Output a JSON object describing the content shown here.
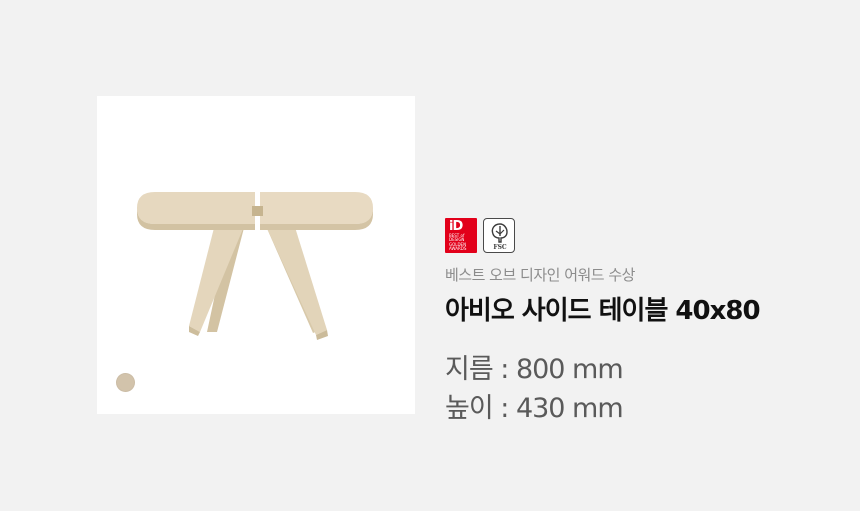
{
  "product": {
    "image": {
      "alt": "아비오 사이드 테이블 40x80 product image",
      "colors": {
        "wood_light": "#e6d8bf",
        "wood_mid": "#ddcfb2",
        "wood_dark": "#c9b894",
        "shadow": "#b9a886"
      }
    },
    "color_swatch": {
      "color": "#d2c3ab"
    },
    "badges": {
      "design_award": {
        "icon": "design-award-logo-icon",
        "color": "#e2001a",
        "logo_text": [
          "BEST of",
          "DESIGN",
          "GOLDEN",
          "AWARDS"
        ]
      },
      "fsc": {
        "icon": "fsc-tree-logo-icon",
        "label": "FSC"
      }
    },
    "subtitle": "베스트 오브 디자인 어워드 수상",
    "title": "아비오 사이드 테이블 40x80",
    "specs": {
      "diameter": "지름 : 800 mm",
      "height": "높이 : 430 mm"
    }
  }
}
